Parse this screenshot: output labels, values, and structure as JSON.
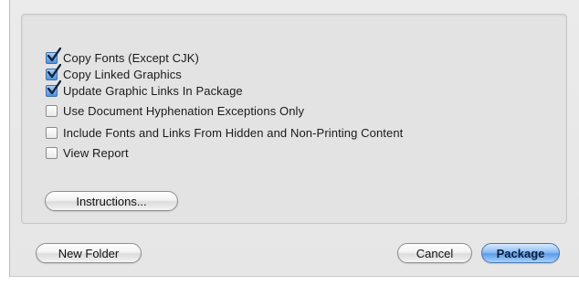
{
  "options": [
    {
      "label": "Copy Fonts (Except CJK)",
      "checked": true
    },
    {
      "label": "Copy Linked Graphics",
      "checked": true
    },
    {
      "label": "Update Graphic Links In Package",
      "checked": true
    },
    {
      "label": "Use Document Hyphenation Exceptions Only",
      "checked": false
    },
    {
      "label": "Include Fonts and Links From Hidden and Non-Printing Content",
      "checked": false
    },
    {
      "label": "View Report",
      "checked": false
    }
  ],
  "buttons": {
    "instructions_label": "Instructions...",
    "new_folder_label": "New Folder",
    "cancel_label": "Cancel",
    "package_label": "Package"
  },
  "colors": {
    "checkbox_checked": "#4f92dd",
    "default_button": "#5d9de8",
    "dialog_background": "#e8e8e8"
  }
}
